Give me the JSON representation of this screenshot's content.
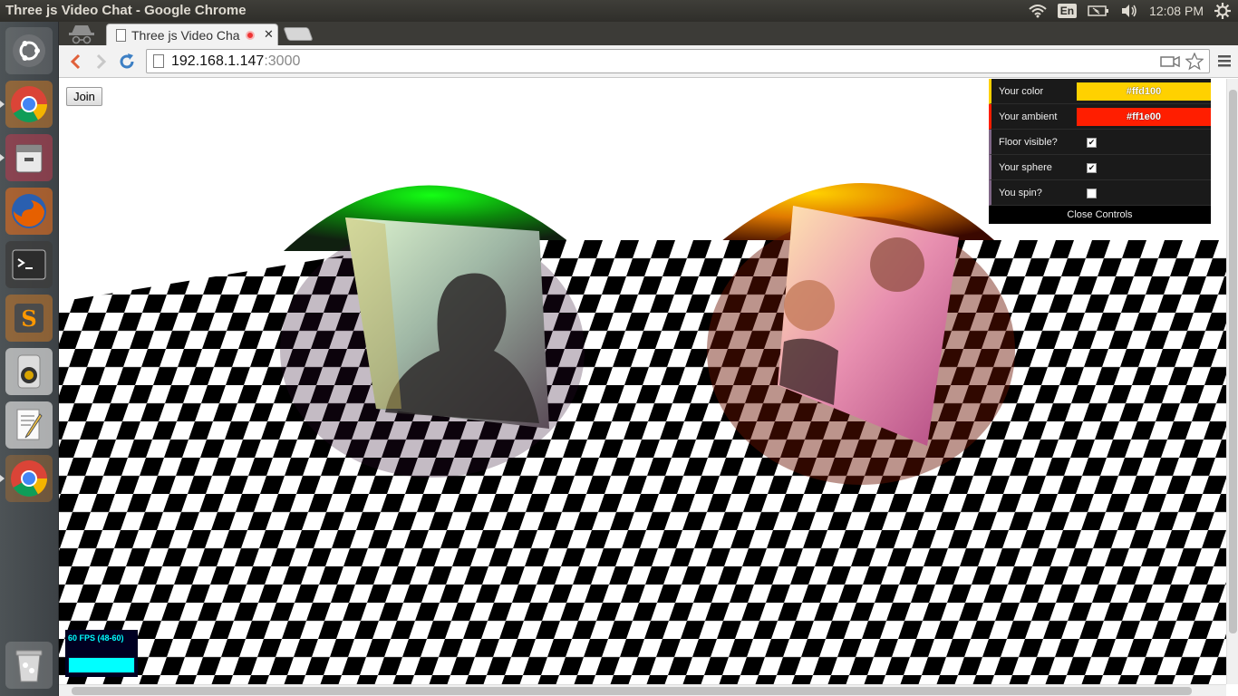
{
  "os": {
    "window_title": "Three js Video Chat - Google Chrome",
    "keyboard_layout": "En",
    "clock": "12:08 PM"
  },
  "launcher": {
    "items": [
      "ubuntu-dash",
      "chrome",
      "file-manager",
      "firefox",
      "terminal",
      "sublime-text",
      "rhythmbox",
      "text-editor",
      "chrome",
      "trash"
    ]
  },
  "browser": {
    "tab_title": "Three js Video Cha",
    "url_host": "192.168.1.147",
    "url_port": ":3000"
  },
  "page": {
    "join_label": "Join",
    "controls": {
      "your_color_label": "Your color",
      "your_color_value": "#ffd100",
      "your_ambient_label": "Your ambient",
      "your_ambient_value": "#ff1e00",
      "floor_visible_label": "Floor visible?",
      "floor_visible": true,
      "your_sphere_label": "Your sphere",
      "your_sphere": true,
      "you_spin_label": "You spin?",
      "you_spin": false,
      "close_label": "Close Controls"
    },
    "stats": {
      "fps_text": "60 FPS (48-60)"
    }
  },
  "colors": {
    "sphere_left": "#14ff14",
    "sphere_right": "#ffd100",
    "swatch_yellow": "#ffd100",
    "swatch_red": "#ff1e00"
  }
}
